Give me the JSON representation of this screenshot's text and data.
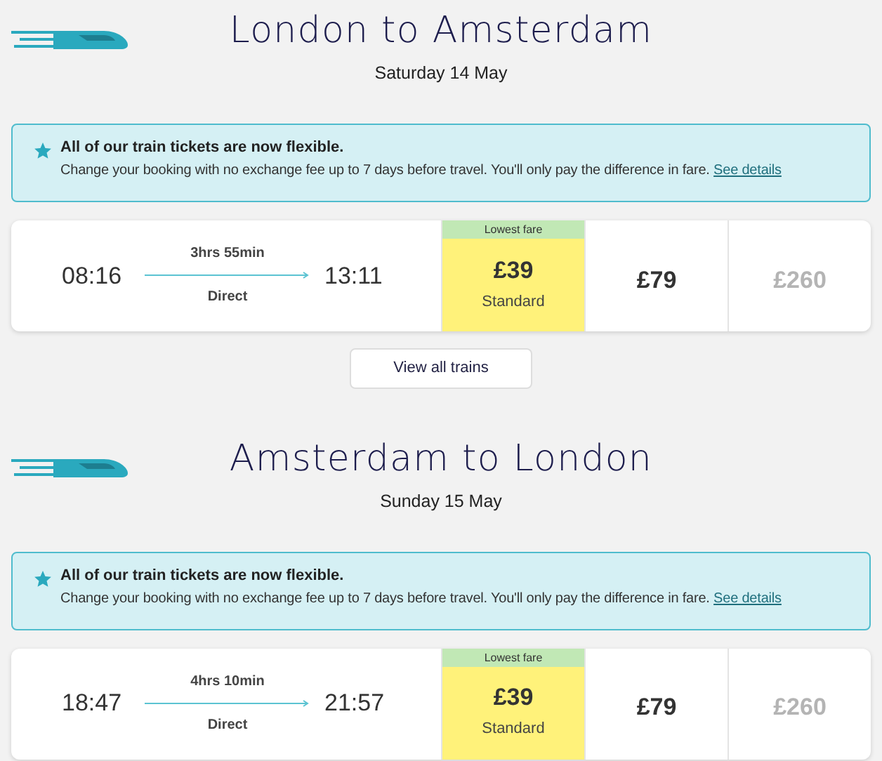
{
  "sections": [
    {
      "title": "London to Amsterdam",
      "date": "Saturday 14 May",
      "notice": {
        "heading": "All of our train tickets are now flexible.",
        "body": "Change your booking with no exchange fee up to 7 days before travel. You'll only pay the difference in fare.",
        "link": "See details"
      },
      "journey": {
        "depart": "08:16",
        "duration": "3hrs 55min",
        "arrive": "13:11",
        "type": "Direct",
        "fares": [
          {
            "kind": "lowest",
            "badge": "Lowest fare",
            "price": "£39",
            "class": "Standard"
          },
          {
            "kind": "normal",
            "price": "£79"
          },
          {
            "kind": "unavailable",
            "price": "£260"
          }
        ]
      },
      "button": "View all trains"
    },
    {
      "title": "Amsterdam to London",
      "date": "Sunday 15 May",
      "notice": {
        "heading": "All of our train tickets are now flexible.",
        "body": "Change your booking with no exchange fee up to 7 days before travel. You'll only pay the difference in fare.",
        "link": "See details"
      },
      "journey": {
        "depart": "18:47",
        "duration": "4hrs 10min",
        "arrive": "21:57",
        "type": "Direct",
        "fares": [
          {
            "kind": "lowest",
            "badge": "Lowest fare",
            "price": "£39",
            "class": "Standard"
          },
          {
            "kind": "normal",
            "price": "£79"
          },
          {
            "kind": "unavailable",
            "price": "£260"
          }
        ]
      }
    }
  ]
}
